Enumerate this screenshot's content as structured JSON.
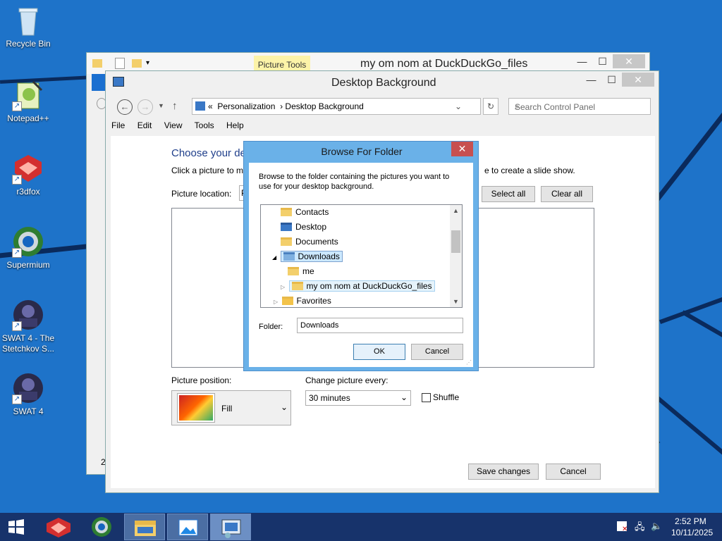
{
  "desktop": {
    "icons": [
      {
        "label": "Recycle Bin",
        "icon": "recycle-bin-icon"
      },
      {
        "label": "Notepad++",
        "icon": "notepadpp-icon"
      },
      {
        "label": "r3dfox",
        "icon": "r3dfox-icon"
      },
      {
        "label": "Supermium",
        "icon": "supermium-icon"
      },
      {
        "label": "SWAT 4 - The Stetchkov S...",
        "icon": "swat4-icon"
      },
      {
        "label": "SWAT 4",
        "icon": "swat4-icon"
      }
    ]
  },
  "explorer": {
    "context_tab": "Picture Tools",
    "title": "my om nom at DuckDuckGo_files",
    "side_num": "2"
  },
  "control_panel": {
    "title": "Desktop Background",
    "breadcrumb_prefix": "«",
    "breadcrumb": [
      "Personalization",
      "Desktop Background"
    ],
    "search_placeholder": "Search Control Panel",
    "menu": [
      "File",
      "Edit",
      "View",
      "Tools",
      "Help"
    ],
    "heading": "Choose your de",
    "subline_left": "Click a picture to m",
    "subline_right": "e to create a slide show.",
    "picture_location_label": "Picture location:",
    "picture_location_value": "P",
    "select_all": "Select all",
    "clear_all": "Clear all",
    "picture_position_label": "Picture position:",
    "picture_position_value": "Fill",
    "change_every_label": "Change picture every:",
    "change_every_value": "30 minutes",
    "shuffle_label": "Shuffle",
    "shuffle_checked": false,
    "save_changes": "Save changes",
    "cancel": "Cancel"
  },
  "dialog": {
    "title": "Browse For Folder",
    "instructions": "Browse to the folder containing the pictures you want to use for your desktop background.",
    "tree": [
      {
        "label": "Contacts",
        "indent": 1,
        "expander": ""
      },
      {
        "label": "Desktop",
        "indent": 1,
        "expander": ""
      },
      {
        "label": "Documents",
        "indent": 1,
        "expander": ""
      },
      {
        "label": "Downloads",
        "indent": 1,
        "expander": "◢",
        "selected": true
      },
      {
        "label": "me",
        "indent": 2,
        "expander": ""
      },
      {
        "label": "my om nom at DuckDuckGo_files",
        "indent": 2,
        "expander": "▷",
        "hover": true
      },
      {
        "label": "Favorites",
        "indent": 1,
        "expander": "▷"
      }
    ],
    "folder_label": "Folder:",
    "folder_value": "Downloads",
    "ok": "OK",
    "cancel": "Cancel"
  },
  "taskbar": {
    "time": "2:52 PM",
    "date": "10/11/2025"
  },
  "colors": {
    "desktop": "#1e73c9",
    "taskbar": "#17336b",
    "dialog_frame": "#6ab1e8",
    "close_red": "#c75050"
  }
}
